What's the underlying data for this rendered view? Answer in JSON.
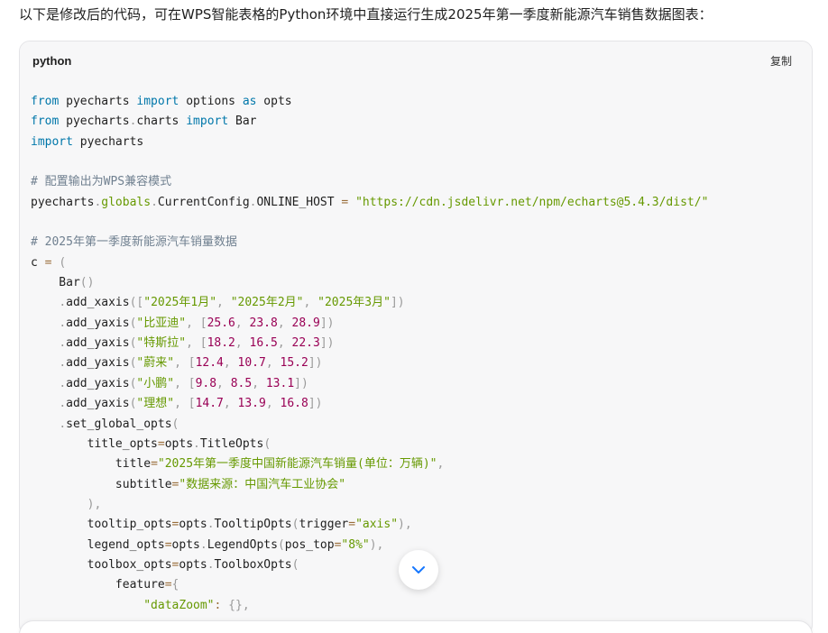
{
  "intro_text": "以下是修改后的代码，可在WPS智能表格的Python环境中直接运行生成2025年第一季度新能源汽车销售数据图表：",
  "code_block": {
    "language": "python",
    "copy_label": "复制",
    "lines": [
      [
        [
          "kw",
          "from"
        ],
        [
          "plain",
          " pyecharts "
        ],
        [
          "kw",
          "import"
        ],
        [
          "plain",
          " options "
        ],
        [
          "kw",
          "as"
        ],
        [
          "plain",
          " opts"
        ]
      ],
      [
        [
          "kw",
          "from"
        ],
        [
          "plain",
          " pyecharts"
        ],
        [
          "punc",
          "."
        ],
        [
          "plain",
          "charts "
        ],
        [
          "kw",
          "import"
        ],
        [
          "plain",
          " Bar"
        ]
      ],
      [
        [
          "kw",
          "import"
        ],
        [
          "plain",
          " pyecharts"
        ]
      ],
      [],
      [
        [
          "com",
          "# 配置输出为WPS兼容模式"
        ]
      ],
      [
        [
          "plain",
          "pyecharts"
        ],
        [
          "punc",
          "."
        ],
        [
          "attr",
          "globals"
        ],
        [
          "punc",
          "."
        ],
        [
          "plain",
          "CurrentConfig"
        ],
        [
          "punc",
          "."
        ],
        [
          "plain",
          "ONLINE_HOST "
        ],
        [
          "op",
          "="
        ],
        [
          "plain",
          " "
        ],
        [
          "str",
          "\"https://cdn.jsdelivr.net/npm/echarts@5.4.3/dist/\""
        ]
      ],
      [],
      [
        [
          "com",
          "# 2025年第一季度新能源汽车销量数据"
        ]
      ],
      [
        [
          "plain",
          "c "
        ],
        [
          "op",
          "="
        ],
        [
          "plain",
          " "
        ],
        [
          "punc",
          "("
        ]
      ],
      [
        [
          "plain",
          "    Bar"
        ],
        [
          "punc",
          "()"
        ]
      ],
      [
        [
          "plain",
          "    "
        ],
        [
          "punc",
          "."
        ],
        [
          "fn",
          "add_xaxis"
        ],
        [
          "punc",
          "(["
        ],
        [
          "str",
          "\"2025年1月\""
        ],
        [
          "punc",
          ","
        ],
        [
          "plain",
          " "
        ],
        [
          "str",
          "\"2025年2月\""
        ],
        [
          "punc",
          ","
        ],
        [
          "plain",
          " "
        ],
        [
          "str",
          "\"2025年3月\""
        ],
        [
          "punc",
          "])"
        ]
      ],
      [
        [
          "plain",
          "    "
        ],
        [
          "punc",
          "."
        ],
        [
          "fn",
          "add_yaxis"
        ],
        [
          "punc",
          "("
        ],
        [
          "str",
          "\"比亚迪\""
        ],
        [
          "punc",
          ","
        ],
        [
          "plain",
          " "
        ],
        [
          "punc",
          "["
        ],
        [
          "num",
          "25.6"
        ],
        [
          "punc",
          ","
        ],
        [
          "plain",
          " "
        ],
        [
          "num",
          "23.8"
        ],
        [
          "punc",
          ","
        ],
        [
          "plain",
          " "
        ],
        [
          "num",
          "28.9"
        ],
        [
          "punc",
          "])"
        ]
      ],
      [
        [
          "plain",
          "    "
        ],
        [
          "punc",
          "."
        ],
        [
          "fn",
          "add_yaxis"
        ],
        [
          "punc",
          "("
        ],
        [
          "str",
          "\"特斯拉\""
        ],
        [
          "punc",
          ","
        ],
        [
          "plain",
          " "
        ],
        [
          "punc",
          "["
        ],
        [
          "num",
          "18.2"
        ],
        [
          "punc",
          ","
        ],
        [
          "plain",
          " "
        ],
        [
          "num",
          "16.5"
        ],
        [
          "punc",
          ","
        ],
        [
          "plain",
          " "
        ],
        [
          "num",
          "22.3"
        ],
        [
          "punc",
          "])"
        ]
      ],
      [
        [
          "plain",
          "    "
        ],
        [
          "punc",
          "."
        ],
        [
          "fn",
          "add_yaxis"
        ],
        [
          "punc",
          "("
        ],
        [
          "str",
          "\"蔚来\""
        ],
        [
          "punc",
          ","
        ],
        [
          "plain",
          " "
        ],
        [
          "punc",
          "["
        ],
        [
          "num",
          "12.4"
        ],
        [
          "punc",
          ","
        ],
        [
          "plain",
          " "
        ],
        [
          "num",
          "10.7"
        ],
        [
          "punc",
          ","
        ],
        [
          "plain",
          " "
        ],
        [
          "num",
          "15.2"
        ],
        [
          "punc",
          "])"
        ]
      ],
      [
        [
          "plain",
          "    "
        ],
        [
          "punc",
          "."
        ],
        [
          "fn",
          "add_yaxis"
        ],
        [
          "punc",
          "("
        ],
        [
          "str",
          "\"小鹏\""
        ],
        [
          "punc",
          ","
        ],
        [
          "plain",
          " "
        ],
        [
          "punc",
          "["
        ],
        [
          "num",
          "9.8"
        ],
        [
          "punc",
          ","
        ],
        [
          "plain",
          " "
        ],
        [
          "num",
          "8.5"
        ],
        [
          "punc",
          ","
        ],
        [
          "plain",
          " "
        ],
        [
          "num",
          "13.1"
        ],
        [
          "punc",
          "])"
        ]
      ],
      [
        [
          "plain",
          "    "
        ],
        [
          "punc",
          "."
        ],
        [
          "fn",
          "add_yaxis"
        ],
        [
          "punc",
          "("
        ],
        [
          "str",
          "\"理想\""
        ],
        [
          "punc",
          ","
        ],
        [
          "plain",
          " "
        ],
        [
          "punc",
          "["
        ],
        [
          "num",
          "14.7"
        ],
        [
          "punc",
          ","
        ],
        [
          "plain",
          " "
        ],
        [
          "num",
          "13.9"
        ],
        [
          "punc",
          ","
        ],
        [
          "plain",
          " "
        ],
        [
          "num",
          "16.8"
        ],
        [
          "punc",
          "])"
        ]
      ],
      [
        [
          "plain",
          "    "
        ],
        [
          "punc",
          "."
        ],
        [
          "fn",
          "set_global_opts"
        ],
        [
          "punc",
          "("
        ]
      ],
      [
        [
          "plain",
          "        title_opts"
        ],
        [
          "op",
          "="
        ],
        [
          "plain",
          "opts"
        ],
        [
          "punc",
          "."
        ],
        [
          "fn",
          "TitleOpts"
        ],
        [
          "punc",
          "("
        ]
      ],
      [
        [
          "plain",
          "            title"
        ],
        [
          "op",
          "="
        ],
        [
          "str",
          "\"2025年第一季度中国新能源汽车销量(单位：万辆)\""
        ],
        [
          "punc",
          ","
        ]
      ],
      [
        [
          "plain",
          "            subtitle"
        ],
        [
          "op",
          "="
        ],
        [
          "str",
          "\"数据来源：中国汽车工业协会\""
        ]
      ],
      [
        [
          "plain",
          "        "
        ],
        [
          "punc",
          "),"
        ]
      ],
      [
        [
          "plain",
          "        tooltip_opts"
        ],
        [
          "op",
          "="
        ],
        [
          "plain",
          "opts"
        ],
        [
          "punc",
          "."
        ],
        [
          "fn",
          "TooltipOpts"
        ],
        [
          "punc",
          "("
        ],
        [
          "plain",
          "trigger"
        ],
        [
          "op",
          "="
        ],
        [
          "str",
          "\"axis\""
        ],
        [
          "punc",
          "),"
        ]
      ],
      [
        [
          "plain",
          "        legend_opts"
        ],
        [
          "op",
          "="
        ],
        [
          "plain",
          "opts"
        ],
        [
          "punc",
          "."
        ],
        [
          "fn",
          "LegendOpts"
        ],
        [
          "punc",
          "("
        ],
        [
          "plain",
          "pos_top"
        ],
        [
          "op",
          "="
        ],
        [
          "str",
          "\"8%\""
        ],
        [
          "punc",
          "),"
        ]
      ],
      [
        [
          "plain",
          "        toolbox_opts"
        ],
        [
          "op",
          "="
        ],
        [
          "plain",
          "opts"
        ],
        [
          "punc",
          "."
        ],
        [
          "fn",
          "ToolboxOpts"
        ],
        [
          "punc",
          "("
        ]
      ],
      [
        [
          "plain",
          "            feature"
        ],
        [
          "op",
          "="
        ],
        [
          "punc",
          "{"
        ]
      ],
      [
        [
          "plain",
          "                "
        ],
        [
          "str",
          "\"dataZoom\""
        ],
        [
          "op",
          ":"
        ],
        [
          "plain",
          " "
        ],
        [
          "punc",
          "{},"
        ]
      ]
    ]
  },
  "scroll_button": {
    "icon": "chevron-down-icon",
    "color": "#1677ff"
  }
}
